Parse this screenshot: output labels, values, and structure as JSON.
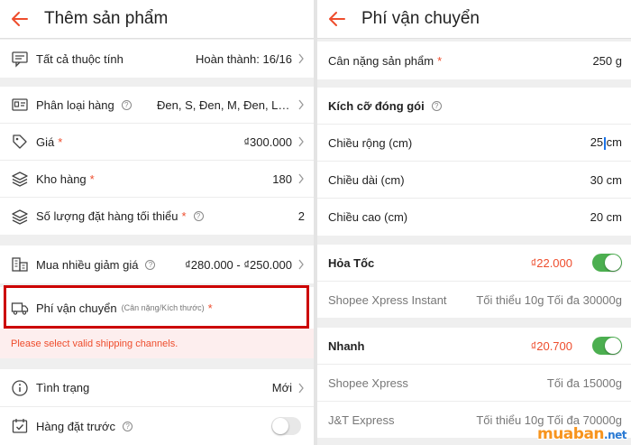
{
  "left": {
    "title": "Thêm sản phẩm",
    "attributes": {
      "label": "Tất cả thuộc tính",
      "value": "Hoàn thành: 16/16"
    },
    "variants": {
      "label": "Phân loại hàng",
      "value": "Đen, S, Đen, M, Đen, L, Trắ..."
    },
    "price": {
      "label": "Giá",
      "required": "*",
      "value": "₫300.000"
    },
    "stock": {
      "label": "Kho hàng",
      "required": "*",
      "value": "180"
    },
    "min_order": {
      "label": "Số lượng đặt hàng tối thiểu",
      "required": "*",
      "value": "2"
    },
    "bulk_discount": {
      "label": "Mua nhiều giảm giá",
      "value": "₫280.000 - ₫250.000"
    },
    "shipping": {
      "label": "Phí vận chuyển",
      "hint": "(Cân nặng/Kích thước)",
      "required": "*"
    },
    "shipping_error": "Please select valid shipping channels.",
    "condition": {
      "label": "Tình trạng",
      "value": "Mới"
    },
    "preorder": {
      "label": "Hàng đặt trước",
      "enabled": false
    }
  },
  "right": {
    "title": "Phí vận chuyển",
    "weight": {
      "label": "Cân nặng sản phẩm",
      "required": "*",
      "value": "250 g"
    },
    "package_size": {
      "label": "Kích cỡ đóng gói"
    },
    "width": {
      "label": "Chiều rộng (cm)",
      "value_before": "25",
      "value_after": "cm"
    },
    "length": {
      "label": "Chiều dài (cm)",
      "value": "30 cm"
    },
    "height": {
      "label": "Chiều cao (cm)",
      "value": "20 cm"
    },
    "express": {
      "label": "Hỏa Tốc",
      "price": "₫22.000",
      "enabled": true,
      "carrier": "Shopee Xpress Instant",
      "limits": "Tối thiểu 10g Tối đa 30000g"
    },
    "fast": {
      "label": "Nhanh",
      "price": "₫20.700",
      "enabled": true,
      "carriers": [
        {
          "name": "Shopee Xpress",
          "limits": "Tối đa 15000g"
        },
        {
          "name": "J&T Express",
          "limits": "Tối thiểu 10g Tối đa 70000g"
        }
      ]
    }
  },
  "watermark": {
    "brand": "muaban",
    "tld": ".net"
  },
  "colors": {
    "accent": "#ee4d2d",
    "toggle_on": "#4caf50",
    "highlight": "#cc0000"
  }
}
